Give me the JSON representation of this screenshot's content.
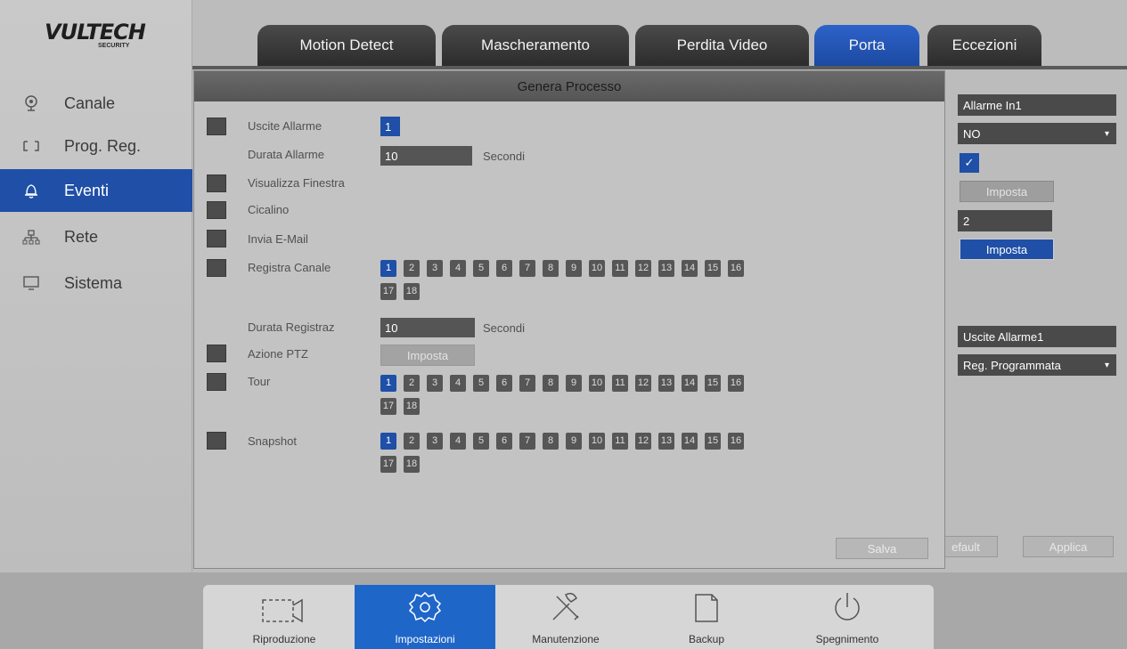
{
  "logo": {
    "brand": "VULTECH",
    "sub": "SECURITY"
  },
  "sidebar": {
    "items": [
      {
        "label": "Canale",
        "icon": "camera-icon",
        "active": false
      },
      {
        "label": "Prog. Reg.",
        "icon": "record-icon",
        "active": false
      },
      {
        "label": "Eventi",
        "icon": "bell-icon",
        "active": true
      },
      {
        "label": "Rete",
        "icon": "network-icon",
        "active": false
      },
      {
        "label": "Sistema",
        "icon": "monitor-icon",
        "active": false
      }
    ]
  },
  "tabs": [
    {
      "label": "Motion Detect",
      "active": false
    },
    {
      "label": "Mascheramento",
      "active": false
    },
    {
      "label": "Perdita Video",
      "active": false
    },
    {
      "label": "Porta",
      "active": true
    },
    {
      "label": "Eccezioni",
      "active": false
    }
  ],
  "right_panel": {
    "alarm_in": "Allarme In1",
    "type_select": "NO",
    "enable_checked": true,
    "imposta_1": "Imposta",
    "value_2": "2",
    "imposta_2": "Imposta",
    "uscita": "Uscite Allarme1",
    "reg_select": "Reg. Programmata",
    "default_btn": "efault",
    "applica_btn": "Applica"
  },
  "dialog": {
    "title": "Genera Processo",
    "uscite_allarme_label": "Uscite Allarme",
    "uscite_allarme_value": "1",
    "durata_allarme_label": "Durata Allarme",
    "durata_allarme_value": "10",
    "secondi_1": "Secondi",
    "visualizza_label": "Visualizza Finestra",
    "cicalino_label": "Cicalino",
    "email_label": "Invia E-Mail",
    "registra_label": "Registra Canale",
    "durata_reg_label": "Durata Registraz",
    "durata_reg_value": "10",
    "secondi_2": "Secondi",
    "ptz_label": "Azione PTZ",
    "ptz_button": "Imposta",
    "tour_label": "Tour",
    "snapshot_label": "Snapshot",
    "salva": "Salva",
    "channels": [
      "1",
      "2",
      "3",
      "4",
      "5",
      "6",
      "7",
      "8",
      "9",
      "10",
      "11",
      "12",
      "13",
      "14",
      "15",
      "16",
      "17",
      "18"
    ],
    "registra_selected": [
      "1"
    ],
    "tour_selected": [
      "1"
    ],
    "snapshot_selected": [
      "1"
    ]
  },
  "bottom_menu": [
    {
      "label": "Riproduzione",
      "icon": "playback-icon",
      "active": false
    },
    {
      "label": "Impostazioni",
      "icon": "settings-gear-icon",
      "active": true
    },
    {
      "label": "Manutenzione",
      "icon": "tools-icon",
      "active": false
    },
    {
      "label": "Backup",
      "icon": "backup-icon",
      "active": false
    },
    {
      "label": "Spegnimento",
      "icon": "power-icon",
      "active": false
    }
  ],
  "colors": {
    "accent": "#1f4fa6",
    "tab_dark": "#3a3a3a",
    "background": "#bcbcbc"
  }
}
